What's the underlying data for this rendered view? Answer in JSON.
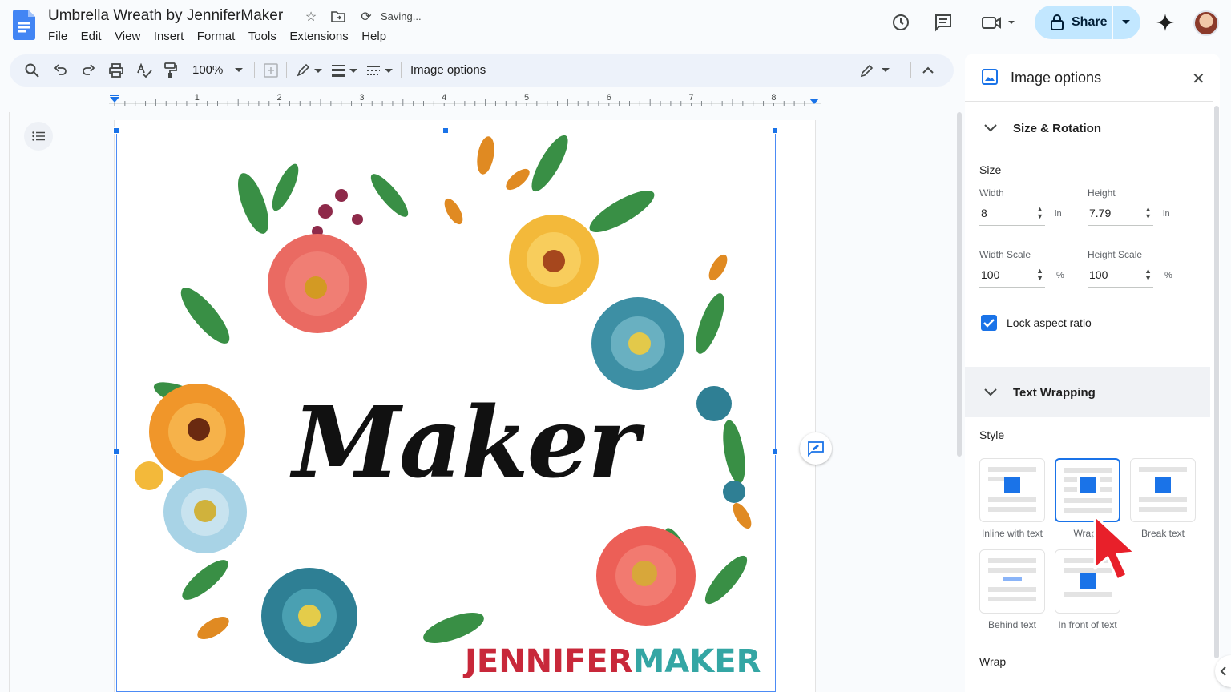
{
  "app": {
    "doc_title": "Umbrella Wreath by JenniferMaker",
    "status": "Saving...",
    "menu": [
      "File",
      "Edit",
      "View",
      "Insert",
      "Format",
      "Tools",
      "Extensions",
      "Help"
    ],
    "share_label": "Share"
  },
  "toolbar": {
    "zoom": "100%",
    "context_label": "Image options"
  },
  "ruler": {
    "marks": [
      "1",
      "2",
      "3",
      "4",
      "5",
      "6",
      "7",
      "8"
    ]
  },
  "document": {
    "image_text_main": "Maker",
    "brand_part1": "JENNIFER",
    "brand_part2": "MAKER"
  },
  "panel": {
    "title": "Image options",
    "size_rotation": {
      "section_title": "Size & Rotation",
      "size_label": "Size",
      "width_label": "Width",
      "width_value": "8",
      "width_unit": "in",
      "height_label": "Height",
      "height_value": "7.79",
      "height_unit": "in",
      "width_scale_label": "Width Scale",
      "width_scale_value": "100",
      "height_scale_label": "Height Scale",
      "height_scale_value": "100",
      "scale_unit": "%",
      "lock_label": "Lock aspect ratio",
      "lock_checked": true
    },
    "text_wrapping": {
      "section_title": "Text Wrapping",
      "style_label": "Style",
      "options": [
        "Inline with text",
        "Wrap text",
        "Break text",
        "Behind text",
        "In front of text"
      ],
      "visible_labels": [
        "Inline with text",
        "Wrap t",
        "Break text",
        "Behind text",
        "In front of text"
      ],
      "selected": "Wrap text",
      "wrap_label": "Wrap"
    }
  },
  "colors": {
    "accent": "#1a73e8",
    "share_bg": "#c2e7ff",
    "brand_red": "#c8283a",
    "brand_teal": "#34a6a4"
  }
}
